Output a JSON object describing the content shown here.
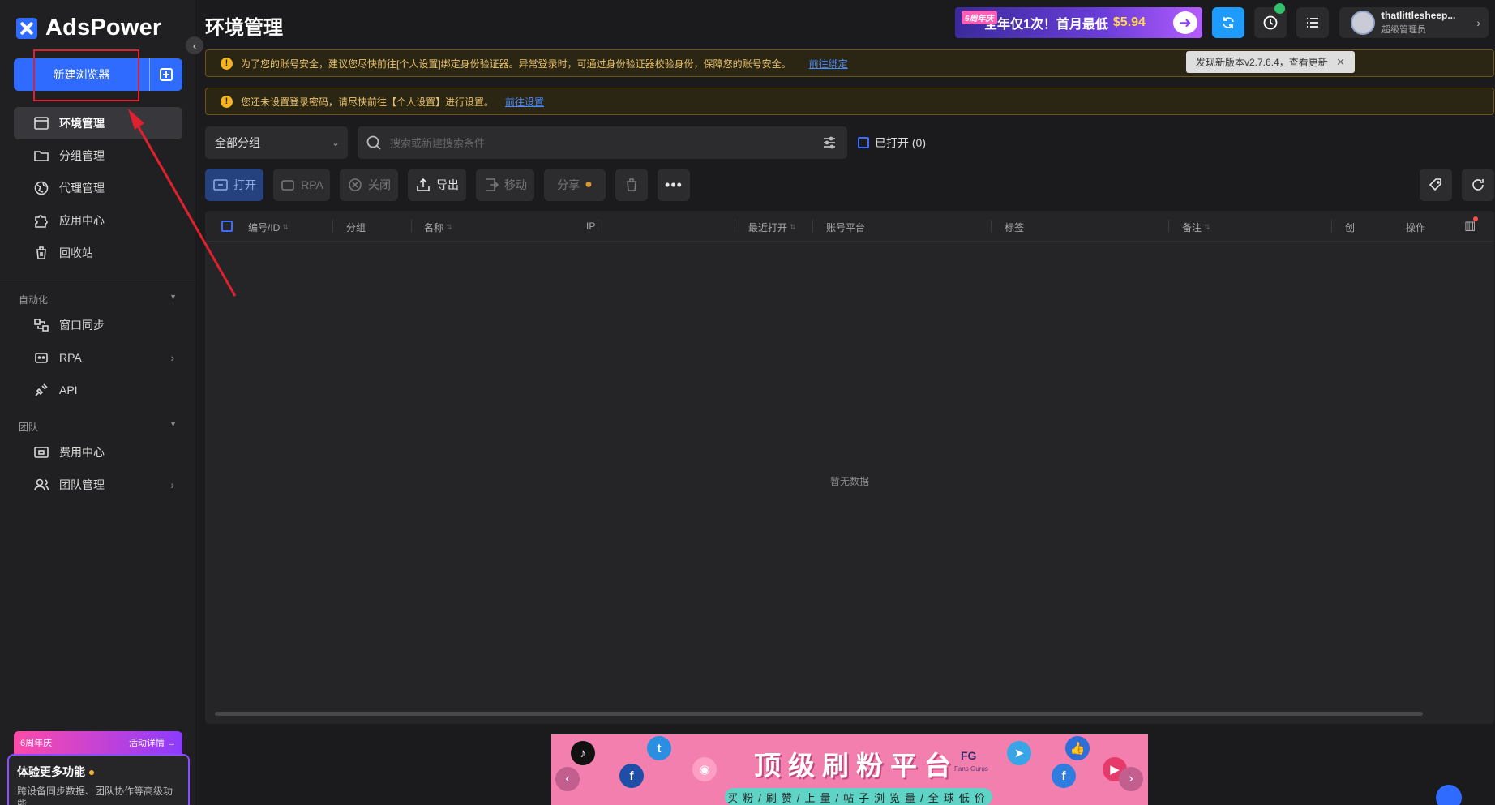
{
  "app": {
    "logo_text": "AdsPower",
    "page_title": "环境管理"
  },
  "sidebar": {
    "new_browser_label": "新建浏览器",
    "items": [
      {
        "label": "环境管理",
        "icon": "browser-window-icon"
      },
      {
        "label": "分组管理",
        "icon": "folder-icon"
      },
      {
        "label": "代理管理",
        "icon": "proxy-globe-icon"
      },
      {
        "label": "应用中心",
        "icon": "puzzle-icon"
      },
      {
        "label": "回收站",
        "icon": "trash-icon"
      }
    ],
    "automation_label": "自动化",
    "automation_items": [
      {
        "label": "窗口同步",
        "icon": "window-sync-icon"
      },
      {
        "label": "RPA",
        "icon": "rpa-robot-icon"
      },
      {
        "label": "API",
        "icon": "api-plug-icon"
      }
    ],
    "team_label": "团队",
    "team_items": [
      {
        "label": "费用中心",
        "icon": "billing-icon"
      },
      {
        "label": "团队管理",
        "icon": "team-users-icon"
      }
    ],
    "promo_left": "6周年庆",
    "promo_right": "活动详情 →",
    "promo_title": "体验更多功能",
    "promo_desc": "跨设备同步数据、团队协作等高级功能"
  },
  "header": {
    "ad_badge": "6周年庆",
    "ad_text": "全年仅1次！首月最低",
    "ad_price": "$5.94",
    "user_name": "thatlittlesheep...",
    "user_role": "超级管理员",
    "update_tooltip": "发现新版本v2.7.6.4，查看更新"
  },
  "notices": [
    {
      "text": "为了您的账号安全，建议您尽快前往[个人设置]绑定身份验证器。异常登录时，可通过身份验证器校验身份，保障您的账号安全。",
      "link": "前往绑定"
    },
    {
      "text": "您还未设置登录密码，请尽快前往【个人设置】进行设置。",
      "link": "前往设置"
    }
  ],
  "filters": {
    "group_select": "全部分组",
    "search_placeholder": "搜索或新建搜索条件",
    "opened_label": "已打开 (0)"
  },
  "toolbar": {
    "open": "打开",
    "rpa": "RPA",
    "close": "关闭",
    "export": "导出",
    "move": "移动",
    "share": "分享"
  },
  "table": {
    "columns": [
      "编号/ID",
      "分组",
      "名称",
      "IP",
      "最近打开",
      "账号平台",
      "标签",
      "备注",
      "创",
      "操作"
    ],
    "empty_text": "暂无数据"
  },
  "ad_banner": {
    "title": "顶级刷粉平台",
    "brand": "Fans Gurus",
    "subtitle": "买粉/刷赞/上量/帖子浏览量/全球低价"
  },
  "colors": {
    "accent": "#2f6bff",
    "warning": "#f5b522",
    "highlight": "#e0202f"
  }
}
